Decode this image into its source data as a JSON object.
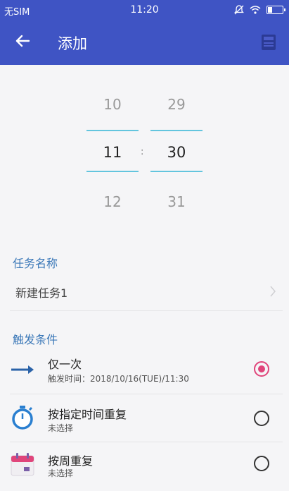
{
  "status": {
    "carrier": "无SIM",
    "time": "11:20"
  },
  "appbar": {
    "title": "添加"
  },
  "picker": {
    "hours": [
      "10",
      "11",
      "12"
    ],
    "minutes": [
      "29",
      "30",
      "31"
    ],
    "separator": ":"
  },
  "task": {
    "label": "任务名称",
    "value": "新建任务1"
  },
  "trigger": {
    "label": "触发条件",
    "options": [
      {
        "title": "仅一次",
        "subtitle": "触发时间：2018/10/16(TUE)/11:30",
        "selected": true
      },
      {
        "title": "按指定时间重复",
        "subtitle": "未选择",
        "selected": false
      },
      {
        "title": "按周重复",
        "subtitle": "未选择",
        "selected": false
      }
    ]
  },
  "colors": {
    "primary": "#3f54c4",
    "accent": "#63c5de",
    "radio_on": "#e0457b",
    "section": "#3b78b8"
  }
}
